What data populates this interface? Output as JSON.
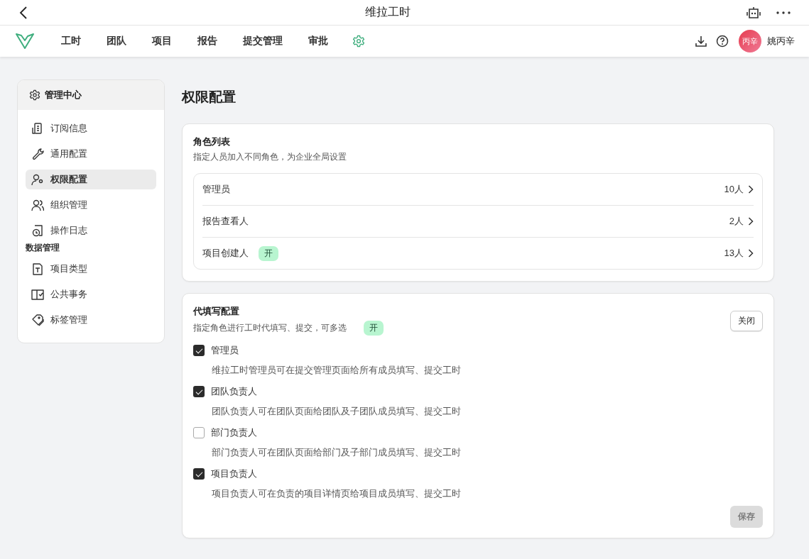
{
  "app": {
    "title": "维拉工时"
  },
  "nav": {
    "items": [
      "工时",
      "团队",
      "项目",
      "报告",
      "提交管理",
      "审批"
    ],
    "user": {
      "avatar_text": "丙辛",
      "name": "姚丙辛"
    }
  },
  "sidebar": {
    "title": "管理中心",
    "items": [
      {
        "kind": "link",
        "label": "订阅信息",
        "selected": false
      },
      {
        "kind": "link",
        "label": "通用配置",
        "selected": false
      },
      {
        "kind": "link",
        "label": "权限配置",
        "selected": true
      },
      {
        "kind": "link",
        "label": "组织管理",
        "selected": false
      },
      {
        "kind": "link",
        "label": "操作日志",
        "selected": false
      },
      {
        "kind": "group",
        "label": "数据管理"
      },
      {
        "kind": "link",
        "label": "项目类型",
        "selected": false
      },
      {
        "kind": "link",
        "label": "公共事务",
        "selected": false
      },
      {
        "kind": "link",
        "label": "标签管理",
        "selected": false
      }
    ]
  },
  "page_title": "权限配置",
  "roles": {
    "title": "角色列表",
    "description": "指定人员加入不同角色，为企业全局设置",
    "rows": [
      {
        "name": "管理员",
        "count": "10人"
      },
      {
        "name": "报告查看人",
        "count": "2人"
      },
      {
        "name": "项目创建人",
        "badge": "开",
        "count": "13人"
      }
    ]
  },
  "proxy": {
    "title": "代填写配置",
    "description": "指定角色进行工时代填写、提交，可多选",
    "badge": "开",
    "close_button": "关闭",
    "options": [
      {
        "label": "管理员",
        "description": "维拉工时管理员可在提交管理页面给所有成员填写、提交工时",
        "checked": true
      },
      {
        "label": "团队负责人",
        "description": "团队负责人可在团队页面给团队及子团队成员填写、提交工时",
        "checked": true
      },
      {
        "label": "部门负责人",
        "description": "部门负责人可在团队页面给部门及子部门成员填写、提交工时",
        "checked": false
      },
      {
        "label": "项目负责人",
        "description": "项目负责人可在负责的项目详情页给项目成员填写、提交工时",
        "checked": true
      }
    ],
    "save_button": {
      "label": "保存",
      "disabled": true
    }
  }
}
